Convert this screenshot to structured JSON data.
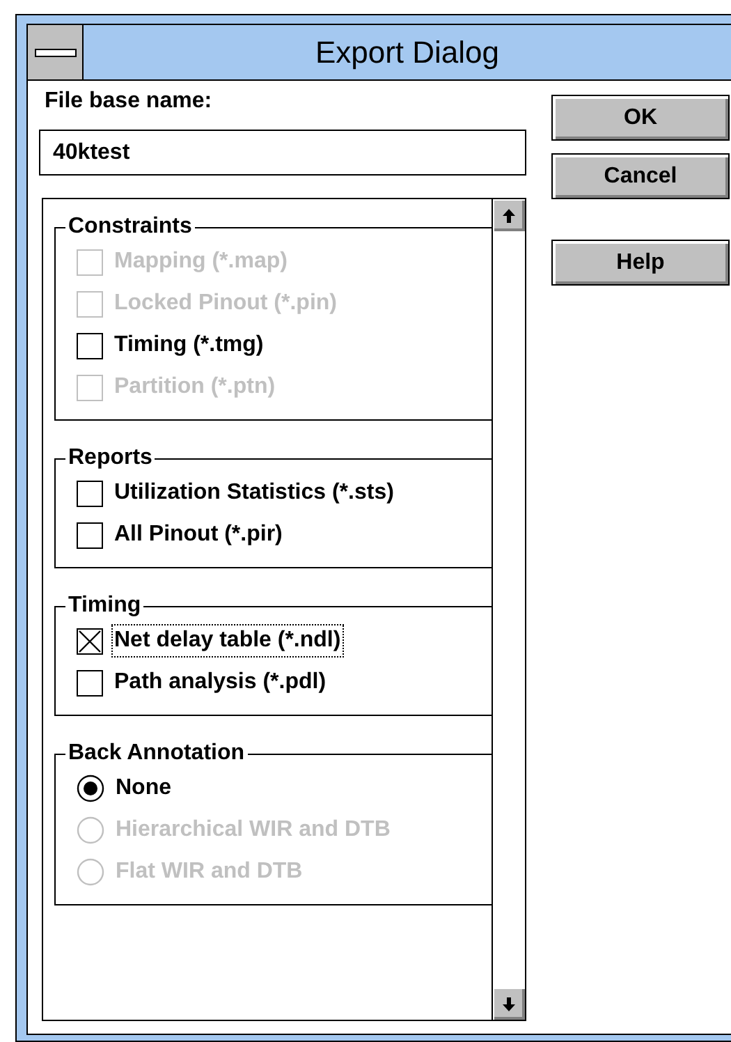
{
  "window": {
    "title": "Export Dialog"
  },
  "file_base_name": {
    "label": "File base name:",
    "value": "40ktest"
  },
  "buttons": [
    "OK",
    "Cancel",
    "Help"
  ],
  "groups": [
    {
      "title": "Constraints",
      "items": [
        {
          "kind": "checkbox",
          "label": "Mapping (*.map)",
          "checked": false,
          "disabled": true,
          "focused": false
        },
        {
          "kind": "checkbox",
          "label": "Locked Pinout (*.pin)",
          "checked": false,
          "disabled": true,
          "focused": false
        },
        {
          "kind": "checkbox",
          "label": "Timing (*.tmg)",
          "checked": false,
          "disabled": false,
          "focused": false
        },
        {
          "kind": "checkbox",
          "label": "Partition (*.ptn)",
          "checked": false,
          "disabled": true,
          "focused": false
        }
      ]
    },
    {
      "title": "Reports",
      "items": [
        {
          "kind": "checkbox",
          "label": "Utilization Statistics (*.sts)",
          "checked": false,
          "disabled": false,
          "focused": false
        },
        {
          "kind": "checkbox",
          "label": "All Pinout (*.pir)",
          "checked": false,
          "disabled": false,
          "focused": false
        }
      ]
    },
    {
      "title": "Timing",
      "items": [
        {
          "kind": "checkbox",
          "label": "Net delay table (*.ndl)",
          "checked": true,
          "disabled": false,
          "focused": true
        },
        {
          "kind": "checkbox",
          "label": "Path analysis (*.pdl)",
          "checked": false,
          "disabled": false,
          "focused": false
        }
      ]
    },
    {
      "title": "Back Annotation",
      "items": [
        {
          "kind": "radio",
          "label": "None",
          "selected": true,
          "disabled": false
        },
        {
          "kind": "radio",
          "label": "Hierarchical WIR and DTB",
          "selected": false,
          "disabled": true
        },
        {
          "kind": "radio",
          "label": "Flat WIR and DTB",
          "selected": false,
          "disabled": true
        }
      ]
    }
  ]
}
